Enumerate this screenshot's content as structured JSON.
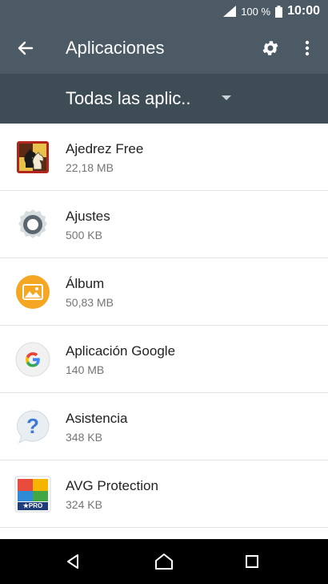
{
  "status_bar": {
    "battery_percent": "100 %",
    "time": "10:00"
  },
  "app_bar": {
    "title": "Aplicaciones",
    "back_icon": "arrow-left-icon",
    "settings_icon": "gear-icon",
    "more_icon": "more-vert-icon"
  },
  "filter": {
    "selected": "Todas las aplic.."
  },
  "apps": [
    {
      "name": "Ajedrez Free",
      "size": "22,18 MB",
      "icon": "chess-icon"
    },
    {
      "name": "Ajustes",
      "size": "500 KB",
      "icon": "settings-app-icon"
    },
    {
      "name": "Álbum",
      "size": "50,83 MB",
      "icon": "album-icon"
    },
    {
      "name": "Aplicación Google",
      "size": "140 MB",
      "icon": "google-icon"
    },
    {
      "name": "Asistencia",
      "size": "348 KB",
      "icon": "help-icon"
    },
    {
      "name": "AVG Protection",
      "size": "324 KB",
      "icon": "avg-icon",
      "badge": "★PRO"
    }
  ],
  "nav_bar": {
    "back": "nav-back-icon",
    "home": "nav-home-icon",
    "recents": "nav-recents-icon"
  },
  "colors": {
    "app_bar": "#4b5a64",
    "filter_bar": "#3e4c55",
    "album": "#f5a623",
    "help": "#3b78d8"
  }
}
